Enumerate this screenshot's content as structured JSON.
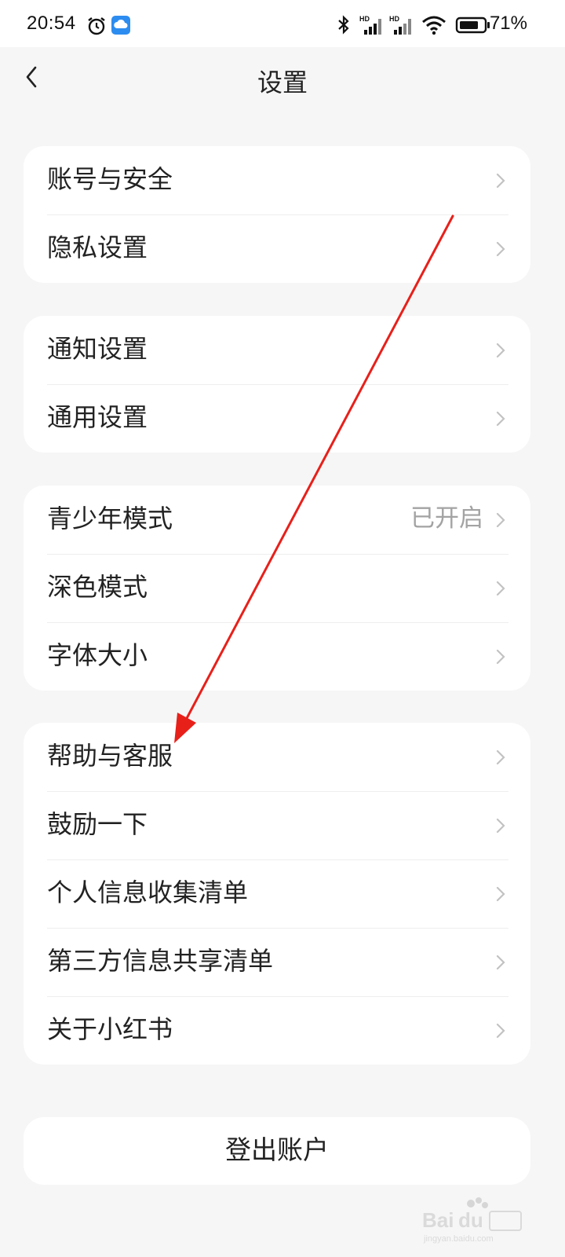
{
  "status_bar": {
    "time": "20:54",
    "battery_percent": "71%"
  },
  "header": {
    "title": "设置"
  },
  "groups": [
    {
      "items": [
        {
          "label": "账号与安全"
        },
        {
          "label": "隐私设置"
        }
      ]
    },
    {
      "items": [
        {
          "label": "通知设置"
        },
        {
          "label": "通用设置"
        }
      ]
    },
    {
      "items": [
        {
          "label": "青少年模式",
          "value": "已开启"
        },
        {
          "label": "深色模式"
        },
        {
          "label": "字体大小"
        }
      ]
    },
    {
      "items": [
        {
          "label": "帮助与客服"
        },
        {
          "label": "鼓励一下"
        },
        {
          "label": "个人信息收集清单"
        },
        {
          "label": "第三方信息共享清单"
        },
        {
          "label": "关于小红书"
        }
      ]
    }
  ],
  "logout": {
    "label": "登出账户"
  },
  "colors": {
    "background": "#f6f6f6",
    "card": "#ffffff",
    "arrow": "#e8201a",
    "secondary_text": "#a3a3a3"
  },
  "icons": [
    "back-icon",
    "chevron-right-icon",
    "alarm-icon",
    "cloud-icon",
    "bluetooth-icon",
    "signal-icon",
    "wifi-icon",
    "battery-icon"
  ]
}
